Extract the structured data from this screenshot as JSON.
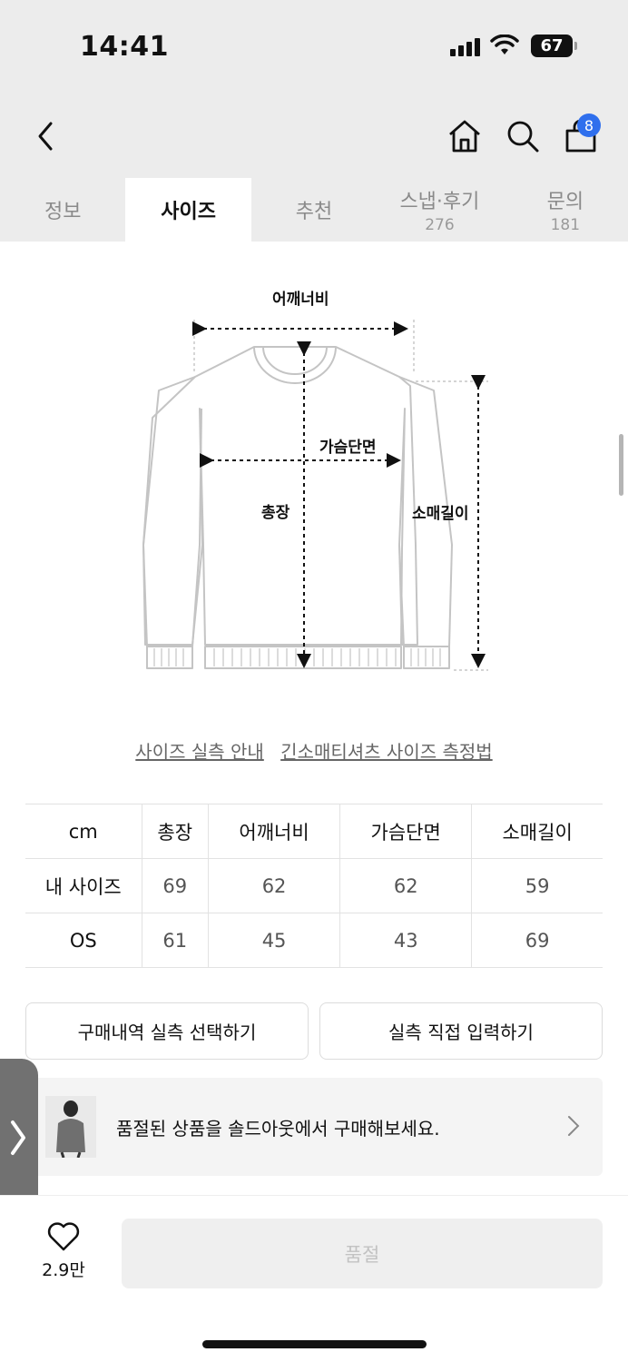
{
  "status": {
    "time": "14:41",
    "battery": "67"
  },
  "nav": {
    "cart_count": "8"
  },
  "tabs": [
    {
      "label": "정보",
      "count": ""
    },
    {
      "label": "사이즈",
      "count": ""
    },
    {
      "label": "추천",
      "count": ""
    },
    {
      "label": "스냅·후기",
      "count": "276"
    },
    {
      "label": "문의",
      "count": "181"
    }
  ],
  "diagram": {
    "shoulder": "어깨너비",
    "chest": "가슴단면",
    "length": "총장",
    "sleeve": "소매길이"
  },
  "links": {
    "guide": "사이즈 실측 안내",
    "method": "긴소매티셔츠 사이즈 측정법"
  },
  "size_table": {
    "header": [
      "cm",
      "총장",
      "어깨너비",
      "가슴단면",
      "소매길이"
    ],
    "rows": [
      [
        "내 사이즈",
        "69",
        "62",
        "62",
        "59"
      ],
      [
        "OS",
        "61",
        "45",
        "43",
        "69"
      ]
    ]
  },
  "buttons": {
    "select_history": "구매내역 실측 선택하기",
    "direct_input": "실측 직접 입력하기"
  },
  "banner": {
    "text": "품절된 상품을 솔드아웃에서 구매해보세요."
  },
  "bottom": {
    "like_count": "2.9만",
    "soldout": "품절"
  }
}
